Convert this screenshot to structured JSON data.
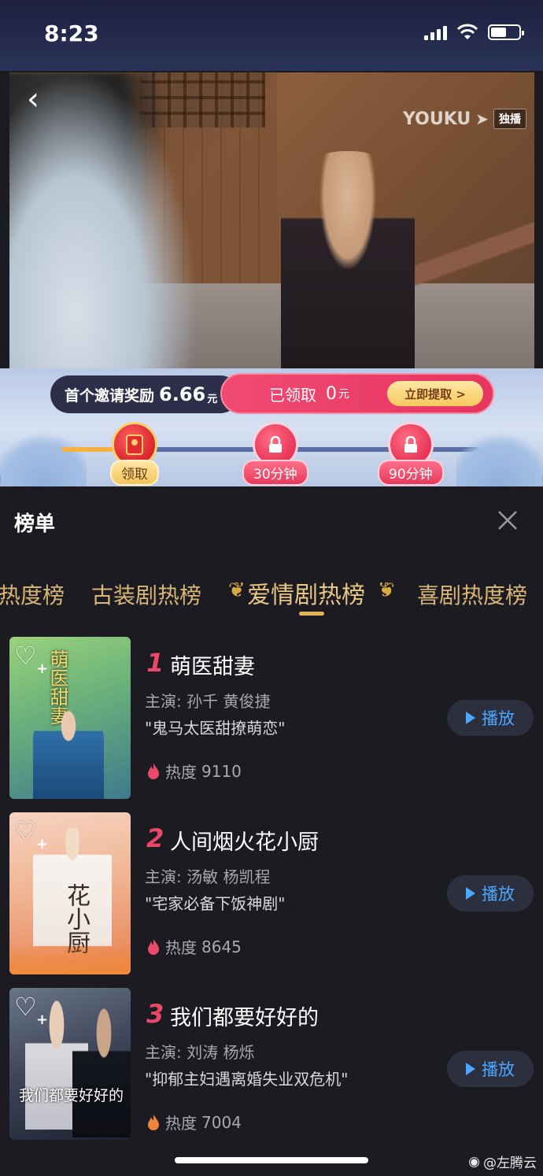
{
  "status_bar": {
    "time": "8:23"
  },
  "video": {
    "brand": "YOUKU",
    "exclusive_badge": "独播"
  },
  "reward": {
    "invite_label": "首个邀请奖励",
    "invite_amount": "6.66",
    "invite_unit": "元",
    "claimed_label": "已领取",
    "claimed_amount": "0",
    "claimed_unit": "元",
    "withdraw_label": "立即提取 >",
    "progress_percent": 18,
    "nodes": [
      {
        "label": "领取"
      },
      {
        "label": "30分钟"
      },
      {
        "label": "90分钟"
      }
    ]
  },
  "panel": {
    "title": "榜单",
    "tabs": [
      {
        "label": "热度榜"
      },
      {
        "label": "古装剧热榜"
      },
      {
        "label": "爱情剧热榜"
      },
      {
        "label": "喜剧热度榜"
      }
    ],
    "active_tab": 2
  },
  "list": [
    {
      "rank": "1",
      "title": "萌医甜妻",
      "cast": "主演: 孙千 黄俊捷",
      "quote": "\"鬼马太医甜撩萌恋\"",
      "heat_label": "热度",
      "heat_value": "9110",
      "play_label": "播放",
      "poster_colors": [
        "#7fbf6d",
        "#3f7a8d"
      ],
      "cover_text": "萌医甜妻"
    },
    {
      "rank": "2",
      "title": "人间烟火花小厨",
      "cast": "主演: 汤敏 杨凯程",
      "quote": "\"宅家必备下饭神剧\"",
      "heat_label": "热度",
      "heat_value": "8645",
      "play_label": "播放",
      "poster_colors": [
        "#f2c0a8",
        "#e77f4f"
      ],
      "cover_text": "花小厨"
    },
    {
      "rank": "3",
      "title": "我们都要好好的",
      "cast": "主演: 刘涛 杨烁",
      "quote": "\"抑郁主妇遇离婚失业双危机\"",
      "heat_label": "热度",
      "heat_value": "7004",
      "play_label": "播放",
      "poster_colors": [
        "#4c5666",
        "#1c2130"
      ],
      "cover_text": "我们都要好好的"
    }
  ],
  "watermark": "@左腾云",
  "colors": {
    "rank_red": "#e94866",
    "tab_gold": "#d7b675",
    "play_blue": "#4ba7ff",
    "claimed_pink": "#f14a72"
  }
}
